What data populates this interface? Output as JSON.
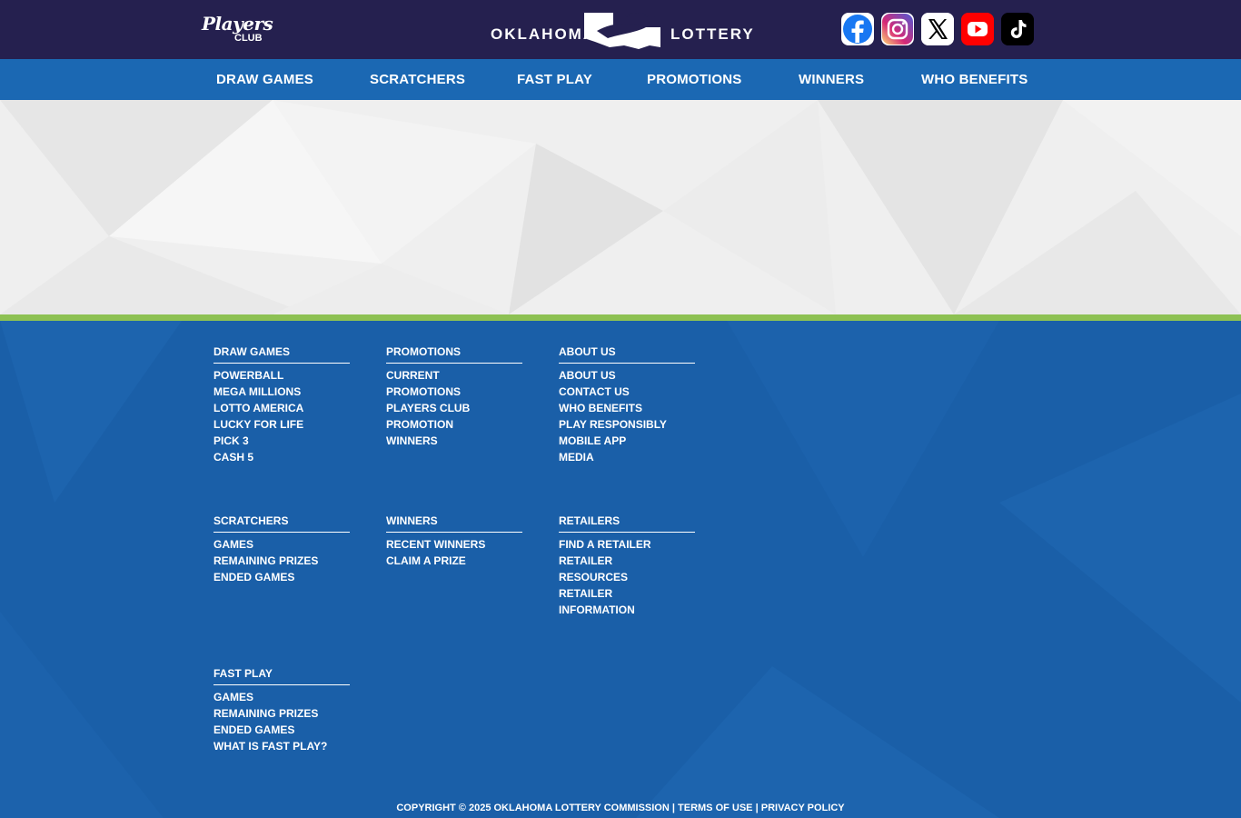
{
  "header": {
    "players_club": {
      "line1": "Players",
      "line2": "CLUB"
    },
    "logo": {
      "left": "OKLAHOMA",
      "right": "LOTTERY"
    },
    "social": [
      {
        "name": "facebook-icon",
        "color": "#1877f2"
      },
      {
        "name": "instagram-icon",
        "color": "#c13584"
      },
      {
        "name": "x-icon",
        "color": "#000000"
      },
      {
        "name": "youtube-icon",
        "color": "#ff0000"
      },
      {
        "name": "tiktok-icon",
        "color": "#000000"
      }
    ]
  },
  "nav": {
    "items": [
      "DRAW GAMES",
      "SCRATCHERS",
      "FAST PLAY",
      "PROMOTIONS",
      "WINNERS",
      "WHO BENEFITS"
    ]
  },
  "footer": {
    "columns": [
      {
        "heading": "DRAW GAMES",
        "links": [
          "POWERBALL",
          "MEGA MILLIONS",
          "LOTTO AMERICA",
          "LUCKY FOR LIFE",
          "PICK 3",
          "CASH 5"
        ]
      },
      {
        "heading": "PROMOTIONS",
        "links": [
          "CURRENT PROMOTIONS",
          "PLAYERS CLUB PROMOTION WINNERS"
        ]
      },
      {
        "heading": "ABOUT US",
        "links": [
          "ABOUT US",
          "CONTACT US",
          "WHO BENEFITS",
          "PLAY RESPONSIBLY",
          "MOBILE APP",
          "MEDIA"
        ]
      },
      {
        "heading": "SCRATCHERS",
        "links": [
          "GAMES",
          "REMAINING PRIZES",
          "ENDED GAMES"
        ]
      },
      {
        "heading": "WINNERS",
        "links": [
          "RECENT WINNERS",
          "CLAIM A PRIZE"
        ]
      },
      {
        "heading": "RETAILERS",
        "links": [
          "FIND A RETAILER",
          "RETAILER RESOURCES",
          "RETAILER INFORMATION"
        ]
      },
      {
        "heading": "FAST PLAY",
        "links": [
          "GAMES",
          "REMAINING PRIZES",
          "ENDED GAMES",
          "WHAT IS FAST PLAY?"
        ]
      }
    ],
    "copyright": "COPYRIGHT © 2025 OKLAHOMA LOTTERY COMMISSION",
    "separator": "|",
    "terms": "TERMS OF USE",
    "privacy": "PRIVACY POLICY"
  },
  "colors": {
    "topbar": "#25204f",
    "nav": "#1b68b3",
    "footer": "#1a5fa8",
    "accent_green": "#8dc153"
  }
}
